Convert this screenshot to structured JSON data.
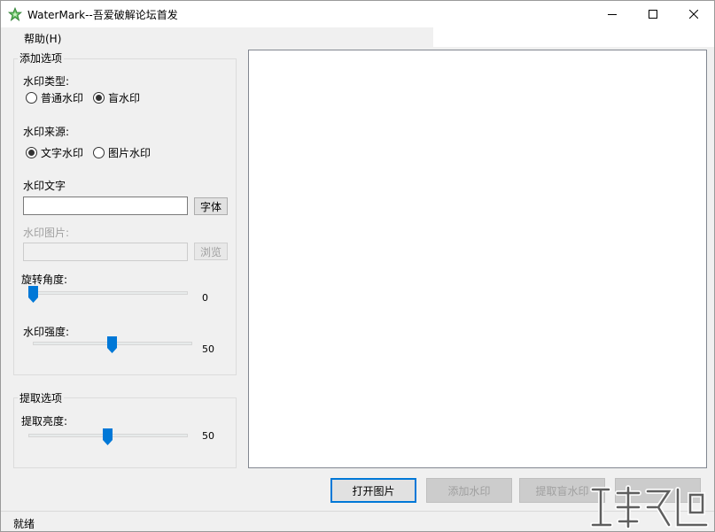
{
  "window": {
    "title": "WaterMark--吾爱破解论坛首发"
  },
  "menu": {
    "help": "帮助(H)"
  },
  "add_options": {
    "group_title": "添加选项",
    "type_label": "水印类型:",
    "type_options": [
      {
        "label": "普通水印",
        "checked": false
      },
      {
        "label": "盲水印",
        "checked": true
      }
    ],
    "source_label": "水印来源:",
    "source_options": [
      {
        "label": "文字水印",
        "checked": true
      },
      {
        "label": "图片水印",
        "checked": false
      }
    ],
    "text_label": "水印文字",
    "text_value": "",
    "font_button": "字体",
    "image_label": "水印图片:",
    "image_value": "",
    "browse_button": "浏览",
    "rotate_label": "旋转角度:",
    "rotate_value": "0",
    "strength_label": "水印强度:",
    "strength_value": "50"
  },
  "extract_options": {
    "group_title": "提取选项",
    "brightness_label": "提取亮度:",
    "brightness_value": "50"
  },
  "actions": {
    "open": "打开图片",
    "add": "添加水印",
    "extract": "提取盲水印"
  },
  "status": {
    "text": "就绪"
  },
  "colors": {
    "accent": "#0078d7",
    "disabled_text": "#a0a0a0",
    "icon_green": "#4caf50"
  }
}
